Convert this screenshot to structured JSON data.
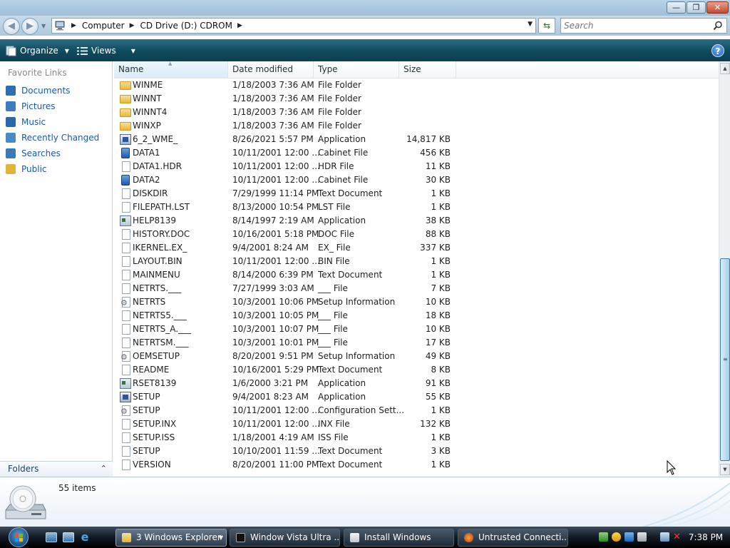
{
  "window": {
    "minimize_glyph": "—",
    "maximize_glyph": "❐",
    "close_glyph": "✕"
  },
  "address": {
    "crumbs": [
      "Computer",
      "CD Drive (D:) CDROM"
    ],
    "separator": "▶"
  },
  "search": {
    "placeholder": "Search"
  },
  "toolbar": {
    "organize_label": "Organize",
    "views_label": "Views",
    "help_label": "?"
  },
  "nav": {
    "title": "Favorite Links",
    "items": [
      {
        "label": "Documents",
        "color": "#2f6db0"
      },
      {
        "label": "Pictures",
        "color": "#3d7cc0"
      },
      {
        "label": "Music",
        "color": "#2b6aa8"
      },
      {
        "label": "Recently Changed",
        "color": "#4a8ac8"
      },
      {
        "label": "Searches",
        "color": "#3b78b6"
      },
      {
        "label": "Public",
        "color": "#e3b33c"
      }
    ],
    "folders_label": "Folders",
    "folders_chevron": "⌃"
  },
  "columns": {
    "name": "Name",
    "date": "Date modified",
    "type": "Type",
    "size": "Size"
  },
  "files": [
    {
      "icon": "folder",
      "name": "WINME",
      "date": "1/18/2003 7:36 AM",
      "type": "File Folder",
      "size": ""
    },
    {
      "icon": "folder",
      "name": "WINNT",
      "date": "1/18/2003 7:36 AM",
      "type": "File Folder",
      "size": ""
    },
    {
      "icon": "folder",
      "name": "WINNT4",
      "date": "1/18/2003 7:36 AM",
      "type": "File Folder",
      "size": ""
    },
    {
      "icon": "folder",
      "name": "WINXP",
      "date": "1/18/2003 7:36 AM",
      "type": "File Folder",
      "size": ""
    },
    {
      "icon": "setup",
      "name": "6_2_WME_",
      "date": "8/26/2021 5:57 PM",
      "type": "Application",
      "size": "14,817 KB"
    },
    {
      "icon": "cab",
      "name": "DATA1",
      "date": "10/11/2001 12:00 ...",
      "type": "Cabinet File",
      "size": "456 KB"
    },
    {
      "icon": "doc",
      "name": "DATA1.HDR",
      "date": "10/11/2001 12:00 ...",
      "type": "HDR File",
      "size": "11 KB"
    },
    {
      "icon": "cab",
      "name": "DATA2",
      "date": "10/11/2001 12:00 ...",
      "type": "Cabinet File",
      "size": "30 KB"
    },
    {
      "icon": "doc",
      "name": "DISKDIR",
      "date": "7/29/1999 11:14 PM",
      "type": "Text Document",
      "size": "1 KB"
    },
    {
      "icon": "doc",
      "name": "FILEPATH.LST",
      "date": "8/13/2000 10:54 PM",
      "type": "LST File",
      "size": "1 KB"
    },
    {
      "icon": "app",
      "name": "HELP8139",
      "date": "8/14/1997 2:19 AM",
      "type": "Application",
      "size": "38 KB"
    },
    {
      "icon": "doc",
      "name": "HISTORY.DOC",
      "date": "10/16/2001 5:18 PM",
      "type": "DOC File",
      "size": "88 KB"
    },
    {
      "icon": "doc",
      "name": "IKERNEL.EX_",
      "date": "9/4/2001 8:24 AM",
      "type": "EX_ File",
      "size": "337 KB"
    },
    {
      "icon": "doc",
      "name": "LAYOUT.BIN",
      "date": "10/11/2001 12:00 ...",
      "type": "BIN File",
      "size": "1 KB"
    },
    {
      "icon": "doc",
      "name": "MAINMENU",
      "date": "8/14/2000 6:39 PM",
      "type": "Text Document",
      "size": "1 KB"
    },
    {
      "icon": "doc",
      "name": "NETRTS.___",
      "date": "7/27/1999 3:03 AM",
      "type": "___ File",
      "size": "7 KB"
    },
    {
      "icon": "inf",
      "name": "NETRTS",
      "date": "10/3/2001 10:06 PM",
      "type": "Setup Information",
      "size": "10 KB"
    },
    {
      "icon": "doc",
      "name": "NETRTS5.___",
      "date": "10/3/2001 10:05 PM",
      "type": "___ File",
      "size": "18 KB"
    },
    {
      "icon": "doc",
      "name": "NETRTS_A.___",
      "date": "10/3/2001 10:07 PM",
      "type": "___ File",
      "size": "10 KB"
    },
    {
      "icon": "doc",
      "name": "NETRTSM.___",
      "date": "10/3/2001 10:01 PM",
      "type": "___ File",
      "size": "17 KB"
    },
    {
      "icon": "inf",
      "name": "OEMSETUP",
      "date": "8/20/2001 9:51 PM",
      "type": "Setup Information",
      "size": "49 KB"
    },
    {
      "icon": "doc",
      "name": "README",
      "date": "10/16/2001 5:29 PM",
      "type": "Text Document",
      "size": "8 KB"
    },
    {
      "icon": "app",
      "name": "RSET8139",
      "date": "1/6/2000 3:21 PM",
      "type": "Application",
      "size": "91 KB"
    },
    {
      "icon": "setup",
      "name": "SETUP",
      "date": "9/4/2001 8:23 AM",
      "type": "Application",
      "size": "55 KB"
    },
    {
      "icon": "inf",
      "name": "SETUP",
      "date": "10/11/2001 12:00 ...",
      "type": "Configuration Sett...",
      "size": "1 KB"
    },
    {
      "icon": "doc",
      "name": "SETUP.INX",
      "date": "10/11/2001 12:00 ...",
      "type": "INX File",
      "size": "132 KB"
    },
    {
      "icon": "doc",
      "name": "SETUP.ISS",
      "date": "1/18/2001 4:19 AM",
      "type": "ISS File",
      "size": "1 KB"
    },
    {
      "icon": "doc",
      "name": "SETUP",
      "date": "10/10/2001 11:59 ...",
      "type": "Text Document",
      "size": "3 KB"
    },
    {
      "icon": "doc",
      "name": "VERSION",
      "date": "8/20/2001 11:00 PM",
      "type": "Text Document",
      "size": "1 KB"
    }
  ],
  "details": {
    "item_count": "55 items"
  },
  "taskbar": {
    "tasks": [
      {
        "label": "3 Windows Explorer"
      },
      {
        "label": "Window Vista Ultra ..."
      },
      {
        "label": "Install Windows"
      },
      {
        "label": "Untrusted Connecti..."
      }
    ],
    "clock": "7:38 PM"
  }
}
